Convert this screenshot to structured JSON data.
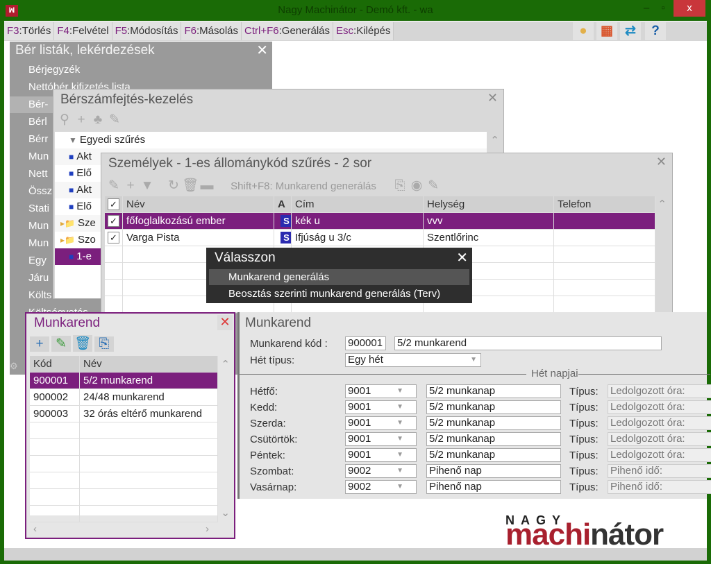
{
  "window": {
    "title": "Nagy Machinátor - Demó kft. - wa",
    "close": "x"
  },
  "toolbar": {
    "items": [
      {
        "key": "F3",
        "label": "Törlés"
      },
      {
        "key": "F4",
        "label": "Felvétel"
      },
      {
        "key": "F5",
        "label": "Módosítás"
      },
      {
        "key": "F6",
        "label": "Másolás"
      },
      {
        "key": "Ctrl+F6",
        "label": "Generálás"
      },
      {
        "key": "Esc",
        "label": "Kilépés"
      }
    ]
  },
  "ber_listak": {
    "title": "Bér listák, lekérdezések",
    "items": [
      "Bérjegyzék",
      "Nettóbér kifizetés lista",
      "Bér-",
      "Bérl",
      "Bérr",
      "Mun",
      "Nett",
      "Össz",
      "Stati",
      "Mun",
      "Mun",
      "Egy",
      "Járu",
      "Költs",
      "Költségvetés"
    ]
  },
  "berszamfejtes": {
    "title": "Bérszámfejtés-kezelés",
    "items": [
      "Egyedi szűrés",
      "Akt",
      "Elő",
      "Akt",
      "Elő",
      "Sze",
      "Szo",
      "1-e"
    ]
  },
  "szemelyek": {
    "title": "Személyek - 1-es állománykód szűrés - 2 sor",
    "shift_f8": "Shift+F8: Munkarend generálás",
    "columns": [
      "Név",
      "A",
      "Cím",
      "Helység",
      "Telefon"
    ],
    "rows": [
      {
        "nev": "főfoglalkozású ember",
        "a": "S",
        "cim": "kék u",
        "helyseg": "vvv",
        "telefon": ""
      },
      {
        "nev": "Varga Pista",
        "a": "S",
        "cim": "Ifjúság u 3/c",
        "helyseg": "Szentlőrinc",
        "telefon": ""
      }
    ]
  },
  "valasszon": {
    "title": "Válasszon",
    "items": [
      "Munkarend generálás",
      "Beosztás szerinti munkarend generálás (Terv)"
    ]
  },
  "munkarend_list": {
    "title": "Munkarend",
    "columns": [
      "Kód",
      "Név"
    ],
    "rows": [
      {
        "kod": "900001",
        "nev": "5/2 munkarend"
      },
      {
        "kod": "900002",
        "nev": "24/48 munkarend"
      },
      {
        "kod": "900003",
        "nev": "32 órás eltérő munkarend"
      }
    ]
  },
  "munkarend_detail": {
    "title": "Munkarend",
    "kod_label": "Munkarend kód :",
    "kod": "900001",
    "nev": "5/2 munkarend",
    "het_tipus_label": "Hét típus:",
    "het_tipus": "Egy hét",
    "het_napjai": "Hét napjai",
    "tipus_label": "Típus:",
    "days": [
      {
        "day": "Hétfő:",
        "code": "9001",
        "name": "5/2 munkanap",
        "tipus": "Ledolgozott óra:"
      },
      {
        "day": "Kedd:",
        "code": "9001",
        "name": "5/2 munkanap",
        "tipus": "Ledolgozott óra:"
      },
      {
        "day": "Szerda:",
        "code": "9001",
        "name": "5/2 munkanap",
        "tipus": "Ledolgozott óra:"
      },
      {
        "day": "Csütörtök:",
        "code": "9001",
        "name": "5/2 munkanap",
        "tipus": "Ledolgozott óra:"
      },
      {
        "day": "Péntek:",
        "code": "9001",
        "name": "5/2 munkanap",
        "tipus": "Ledolgozott óra:"
      },
      {
        "day": "Szombat:",
        "code": "9002",
        "name": "Pihenő nap",
        "tipus": "Pihenő idő:"
      },
      {
        "day": "Vasárnap:",
        "code": "9002",
        "name": "Pihenő nap",
        "tipus": "Pihenő idő:"
      }
    ]
  },
  "logo": {
    "top": "NAGY",
    "bottom_a": "machi",
    "bottom_b": "nátor"
  }
}
